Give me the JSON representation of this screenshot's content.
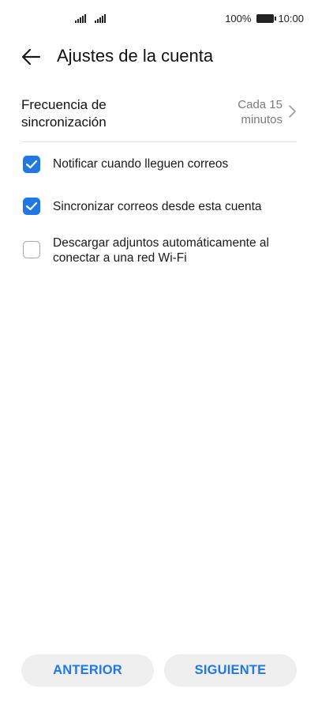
{
  "status_bar": {
    "battery_percent": "100%",
    "time": "10:00"
  },
  "header": {
    "back_icon": "arrow-left-icon",
    "title": "Ajustes de la cuenta"
  },
  "frequency": {
    "label": "Frecuencia de sincronización",
    "value": "Cada 15 minutos",
    "chevron_icon": "chevron-right-icon"
  },
  "options": [
    {
      "label": "Notificar cuando lleguen correos",
      "checked": true
    },
    {
      "label": "Sincronizar correos desde esta cuenta",
      "checked": true
    },
    {
      "label": "Descargar adjuntos automáticamente al conectar a una red Wi-Fi",
      "checked": false
    }
  ],
  "buttons": {
    "previous": "ANTERIOR",
    "next": "SIGUIENTE"
  },
  "colors": {
    "accent": "#1f78e6",
    "button_bg": "#efefef"
  }
}
